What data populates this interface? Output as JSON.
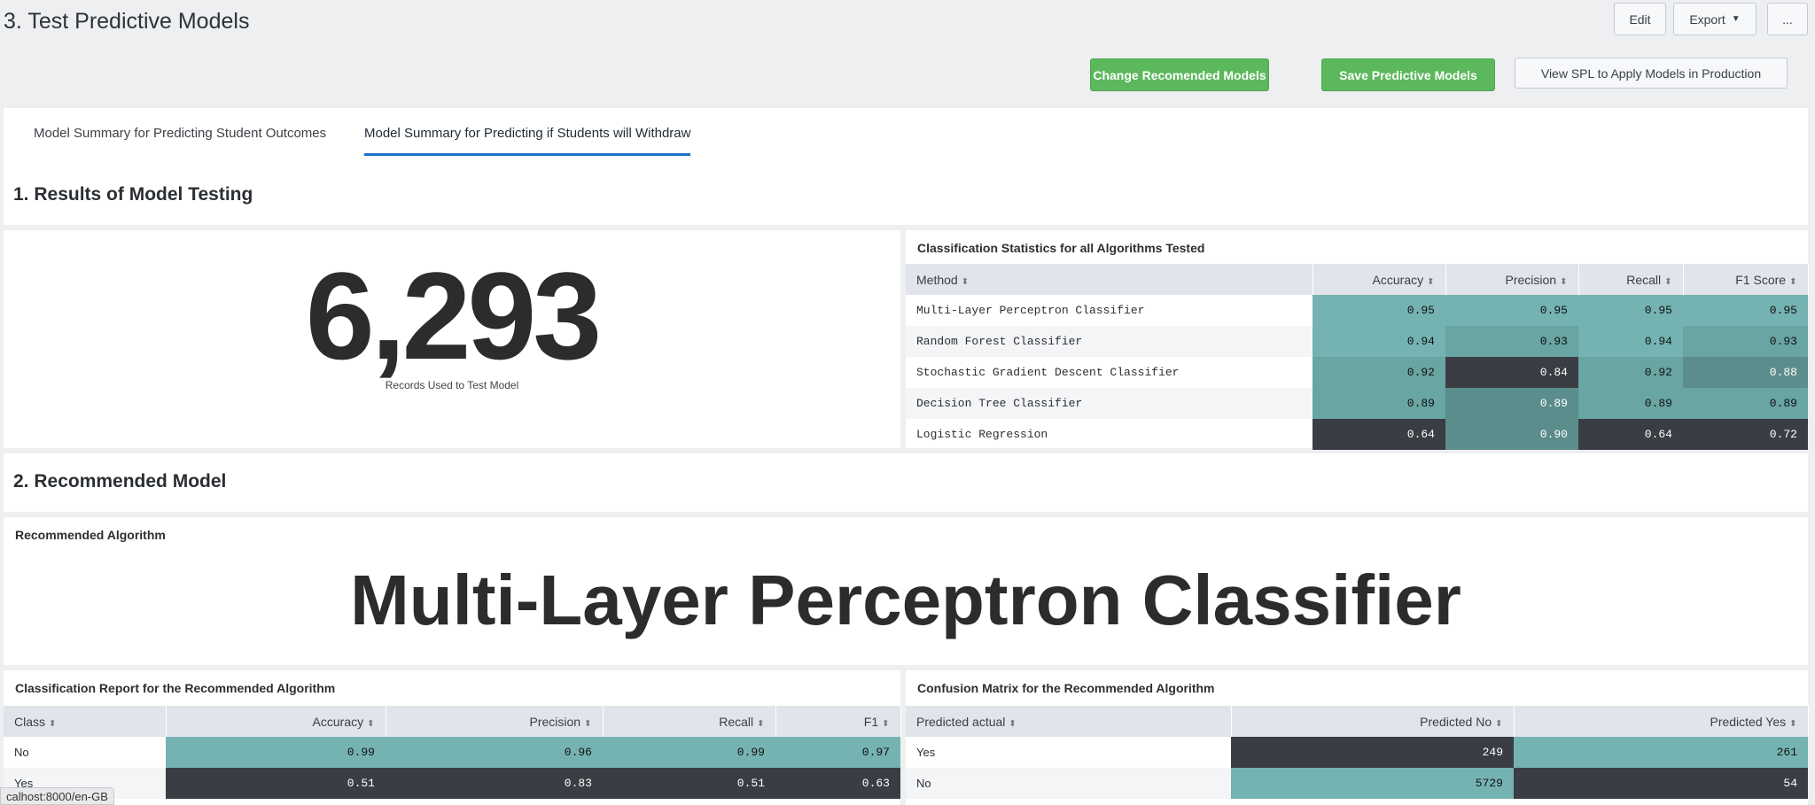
{
  "header": {
    "title": "3. Test Predictive Models",
    "edit_label": "Edit",
    "export_label": "Export",
    "more_label": "...",
    "change_models_label": "Change Recomended Models",
    "save_models_label": "Save Predictive Models",
    "view_spl_label": "View SPL to Apply Models in Production"
  },
  "tabs": [
    {
      "label": "Model Summary for Predicting Student Outcomes",
      "active": false
    },
    {
      "label": "Model Summary for Predicting if Students will Withdraw",
      "active": true
    }
  ],
  "section1": {
    "title": "1. Results of Model Testing",
    "records_value": "6,293",
    "records_label": "Records Used to Test Model"
  },
  "stats_table": {
    "title": "Classification Statistics for all Algorithms Tested",
    "columns": [
      "Method",
      "Accuracy",
      "Precision",
      "Recall",
      "F1 Score"
    ],
    "rows": [
      [
        "Multi-Layer Perceptron Classifier",
        "0.95",
        "0.95",
        "0.95",
        "0.95"
      ],
      [
        "Random Forest Classifier",
        "0.94",
        "0.93",
        "0.94",
        "0.93"
      ],
      [
        "Stochastic Gradient Descent Classifier",
        "0.92",
        "0.84",
        "0.92",
        "0.88"
      ],
      [
        "Decision Tree Classifier",
        "0.89",
        "0.89",
        "0.89",
        "0.89"
      ],
      [
        "Logistic Regression",
        "0.64",
        "0.90",
        "0.64",
        "0.72"
      ]
    ]
  },
  "section2": {
    "title": "2. Recommended Model",
    "panel_title": "Recommended Algorithm",
    "algorithm": "Multi-Layer Perceptron Classifier"
  },
  "report_table": {
    "title": "Classification Report for the Recommended Algorithm",
    "columns": [
      "Class",
      "Accuracy",
      "Precision",
      "Recall",
      "F1"
    ],
    "rows": [
      [
        "No",
        "0.99",
        "0.96",
        "0.99",
        "0.97"
      ],
      [
        "Yes",
        "0.51",
        "0.83",
        "0.51",
        "0.63"
      ]
    ]
  },
  "confusion_table": {
    "title": "Confusion Matrix for the Recommended Algorithm",
    "columns": [
      "Predicted actual",
      "Predicted No",
      "Predicted Yes"
    ],
    "rows": [
      [
        "Yes",
        "249",
        "261"
      ],
      [
        "No",
        "5729",
        "54"
      ]
    ]
  },
  "status_bar": {
    "text": "calhost:8000/en-GB"
  },
  "colors": {
    "accent_green": "#5cb85c",
    "tab_active": "#1a73c6",
    "heat_high": "#74b3b1",
    "heat_low": "#3a3d43"
  }
}
